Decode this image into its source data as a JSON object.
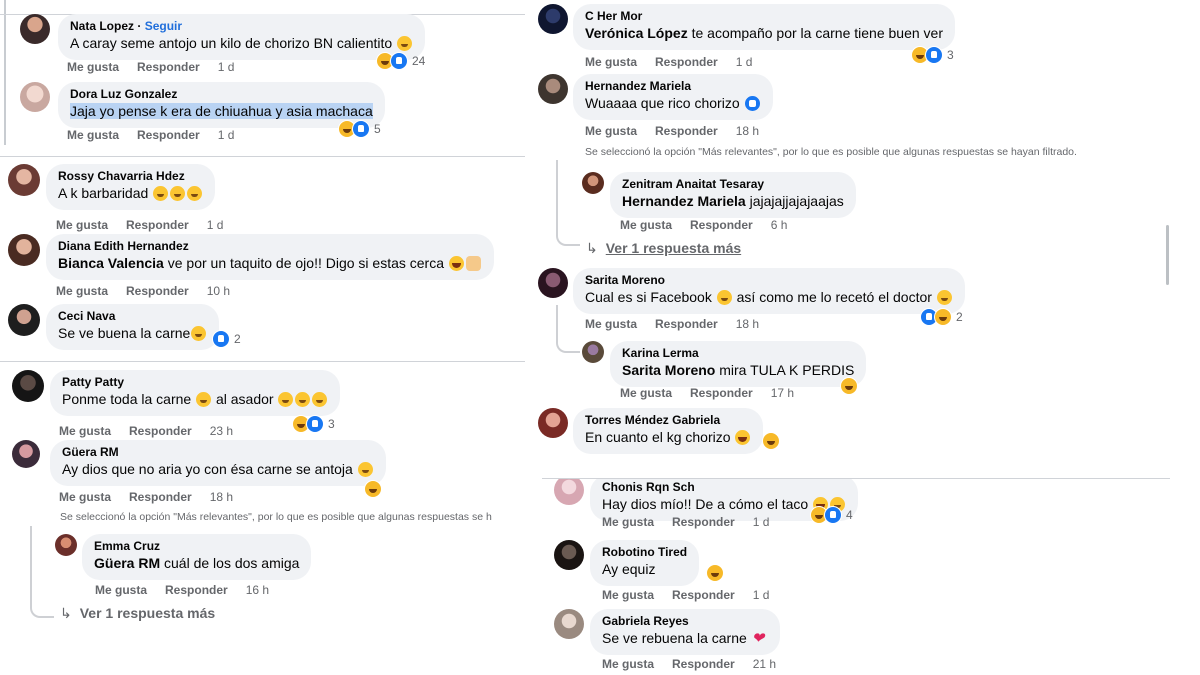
{
  "colors": {
    "bubble": "#f0f2f5",
    "link": "#216fdb",
    "muted": "#65676b",
    "highlight": "#b9d3f3"
  },
  "labels": {
    "like": "Me gusta",
    "reply": "Responder"
  },
  "panel1": {
    "c1": {
      "name": "Nata Lopez",
      "follow": "Seguir",
      "text": "A caray seme antojo un kilo de chorizo BN calientito",
      "time": "1 d",
      "count": "24"
    },
    "c2": {
      "name": "Dora Luz Gonzalez",
      "text": "Jaja yo pense k era de chiuahua y asia machaca",
      "time": "1 d",
      "count": "5"
    }
  },
  "panel2": {
    "c1": {
      "name": "Rossy Chavarria Hdez",
      "text": "A k barbaridad",
      "time": "1 d"
    },
    "c2": {
      "name": "Diana Edith Hernandez",
      "mention": "Bianca Valencia",
      "text": " ve por un taquito de ojo!! Digo si estas cerca",
      "time": "10 h"
    },
    "c3": {
      "name": "Ceci Nava",
      "text": "Se ve buena la carne",
      "count": "2"
    }
  },
  "panel3": {
    "c1": {
      "name": "Patty Patty",
      "text1": "Ponme toda la carne",
      "text2": " al asador",
      "time": "23 h",
      "count": "3"
    },
    "c2": {
      "name": "Güera RM",
      "text": "Ay dios que no aria yo con ésa carne se antoja",
      "time": "18 h"
    },
    "notice": "Se seleccionó la opción \"Más relevantes\", por lo que es posible que algunas respuestas se h",
    "r1": {
      "name": "Emma Cruz",
      "mention": "Güera RM",
      "text": " cuál de los dos amiga",
      "time": "16 h"
    },
    "more": "Ver 1 respuesta más"
  },
  "panel4": {
    "c1": {
      "name": "C Her Mor",
      "mention": "Verónica López",
      "text": " te acompaño por la carne tiene buen ver",
      "time": "1 d",
      "count": "3"
    },
    "c2": {
      "name": "Hernandez Mariela",
      "text": "Wuaaaa que rico chorizo",
      "time": "18 h"
    },
    "notice": "Se seleccionó la opción \"Más relevantes\", por lo que es posible que algunas respuestas se hayan filtrado.",
    "r1": {
      "name": "Zenitram Anaitat Tesaray",
      "mention": "Hernandez Mariela",
      "text": " jajajajjajajaajas",
      "time": "6 h"
    },
    "more": "Ver 1 respuesta más",
    "c3": {
      "name": "Sarita Moreno",
      "text1": "Cual es si Facebook",
      "text2": " así como me lo recetó el doctor",
      "time": "18 h",
      "count": "2"
    },
    "r2": {
      "name": "Karina Lerma",
      "mention": "Sarita Moreno",
      "text": " mira TULA K PERDIS",
      "time": "17 h"
    },
    "c4": {
      "name": "Torres Méndez Gabriela",
      "text": "En cuanto el kg chorizo"
    }
  },
  "panel5": {
    "c1": {
      "name": "Chonis Rqn Sch",
      "text": "Hay dios mío!! De a cómo el taco",
      "time": "1 d",
      "count": "4"
    },
    "c2": {
      "name": "Robotino Tired",
      "text": "Ay equiz",
      "time": "1 d"
    },
    "c3": {
      "name": "Gabriela Reyes",
      "text": "Se ve rebuena la carne",
      "time": "21 h"
    }
  }
}
